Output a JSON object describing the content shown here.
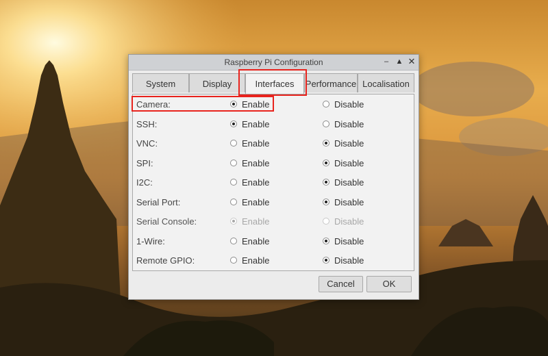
{
  "window": {
    "title": "Raspberry Pi Configuration",
    "minimize_glyph": "–",
    "maximize_glyph": "▲",
    "close_glyph": "✕"
  },
  "tabs": [
    {
      "label": "System",
      "active": false
    },
    {
      "label": "Display",
      "active": false
    },
    {
      "label": "Interfaces",
      "active": true
    },
    {
      "label": "Performance",
      "active": false
    },
    {
      "label": "Localisation",
      "active": false
    }
  ],
  "interfaces": [
    {
      "label": "Camera:",
      "enable_label": "Enable",
      "disable_label": "Disable",
      "selected": "enable",
      "disabled": false
    },
    {
      "label": "SSH:",
      "enable_label": "Enable",
      "disable_label": "Disable",
      "selected": "enable",
      "disabled": false
    },
    {
      "label": "VNC:",
      "enable_label": "Enable",
      "disable_label": "Disable",
      "selected": "disable",
      "disabled": false
    },
    {
      "label": "SPI:",
      "enable_label": "Enable",
      "disable_label": "Disable",
      "selected": "disable",
      "disabled": false
    },
    {
      "label": "I2C:",
      "enable_label": "Enable",
      "disable_label": "Disable",
      "selected": "disable",
      "disabled": false
    },
    {
      "label": "Serial Port:",
      "enable_label": "Enable",
      "disable_label": "Disable",
      "selected": "disable",
      "disabled": false
    },
    {
      "label": "Serial Console:",
      "enable_label": "Enable",
      "disable_label": "Disable",
      "selected": "enable",
      "disabled": true
    },
    {
      "label": "1-Wire:",
      "enable_label": "Enable",
      "disable_label": "Disable",
      "selected": "disable",
      "disabled": false
    },
    {
      "label": "Remote GPIO:",
      "enable_label": "Enable",
      "disable_label": "Disable",
      "selected": "disable",
      "disabled": false
    }
  ],
  "buttons": {
    "cancel_label": "Cancel",
    "ok_label": "OK"
  },
  "colors": {
    "annotation": "#e8231d",
    "sky_top": "#e0a64a",
    "sky_glow": "#fff6c8",
    "silhouette": "#2e2414"
  }
}
